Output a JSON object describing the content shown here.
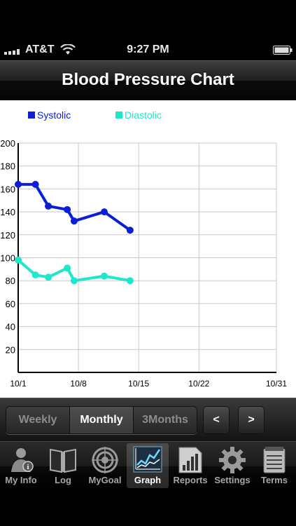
{
  "status_bar": {
    "carrier": "AT&T",
    "time": "9:27 PM",
    "signal_icon": "signal-bars-icon",
    "wifi_icon": "wifi-icon",
    "battery_icon": "battery-icon"
  },
  "header": {
    "title": "Blood Pressure Chart"
  },
  "chart_data": {
    "type": "line",
    "legend_position": "top-left",
    "x_tick_labels": [
      "10/1",
      "10/8",
      "10/15",
      "10/22",
      "10/31"
    ],
    "x_tick_days": [
      1,
      8,
      15,
      22,
      31
    ],
    "x_range": [
      1,
      31
    ],
    "y_tick_labels": [
      "20",
      "40",
      "60",
      "80",
      "100",
      "120",
      "140",
      "160",
      "180",
      "200"
    ],
    "y_range": [
      0,
      200
    ],
    "grid": true,
    "series": [
      {
        "name": "Systolic",
        "color": "#0a1fd6",
        "points": [
          {
            "day": 1,
            "value": 164
          },
          {
            "day": 3,
            "value": 164
          },
          {
            "day": 4.5,
            "value": 145
          },
          {
            "day": 6.7,
            "value": 142
          },
          {
            "day": 7.5,
            "value": 132
          },
          {
            "day": 11,
            "value": 140
          },
          {
            "day": 14,
            "value": 124
          }
        ]
      },
      {
        "name": "Diastolic",
        "color": "#1de8cc",
        "points": [
          {
            "day": 1,
            "value": 98
          },
          {
            "day": 3,
            "value": 85
          },
          {
            "day": 4.5,
            "value": 83
          },
          {
            "day": 6.7,
            "value": 91
          },
          {
            "day": 7.5,
            "value": 80
          },
          {
            "day": 11,
            "value": 84
          },
          {
            "day": 14,
            "value": 80
          }
        ]
      }
    ]
  },
  "range_selector": {
    "options": [
      "Weekly",
      "Monthly",
      "3Months"
    ],
    "selected": "Monthly",
    "prev_label": "<",
    "next_label": ">"
  },
  "tabs": [
    {
      "label": "My Info",
      "icon": "person-info-icon",
      "active": false
    },
    {
      "label": "Log",
      "icon": "open-book-icon",
      "active": false
    },
    {
      "label": "MyGoal",
      "icon": "target-icon",
      "active": false
    },
    {
      "label": "Graph",
      "icon": "line-graph-icon",
      "active": true
    },
    {
      "label": "Reports",
      "icon": "report-document-icon",
      "active": false
    },
    {
      "label": "Settings",
      "icon": "gear-icon",
      "active": false
    },
    {
      "label": "Terms",
      "icon": "notepad-icon",
      "active": false
    }
  ]
}
